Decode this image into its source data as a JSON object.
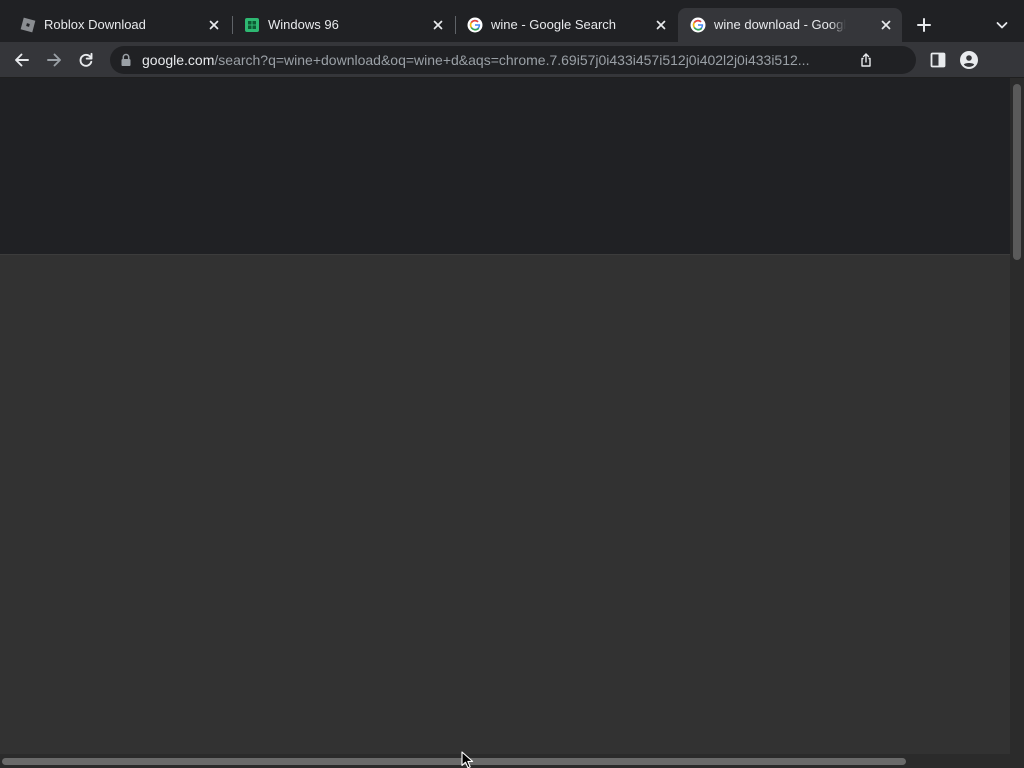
{
  "tabs": [
    {
      "title": "Roblox Download",
      "icon": "roblox-icon",
      "active": false
    },
    {
      "title": "Windows 96",
      "icon": "windows96-icon",
      "active": false
    },
    {
      "title": "wine - Google Search",
      "icon": "google-icon",
      "active": false
    },
    {
      "title": "wine download - Google Search",
      "icon": "google-icon",
      "active": true
    }
  ],
  "toolbar": {
    "url_host": "google.com",
    "url_rest": "/search?q=wine+download&oq=wine+d&aqs=chrome.7.69i57j0i433i457i512j0i402l2j0i433i512..."
  },
  "colors": {
    "tabstrip_bg": "#202124",
    "active_tab_bg": "#35363a",
    "omnibox_bg": "#202124",
    "content_bg": "#323232",
    "text_primary": "#e8eaed",
    "text_secondary": "#9aa0a6"
  }
}
